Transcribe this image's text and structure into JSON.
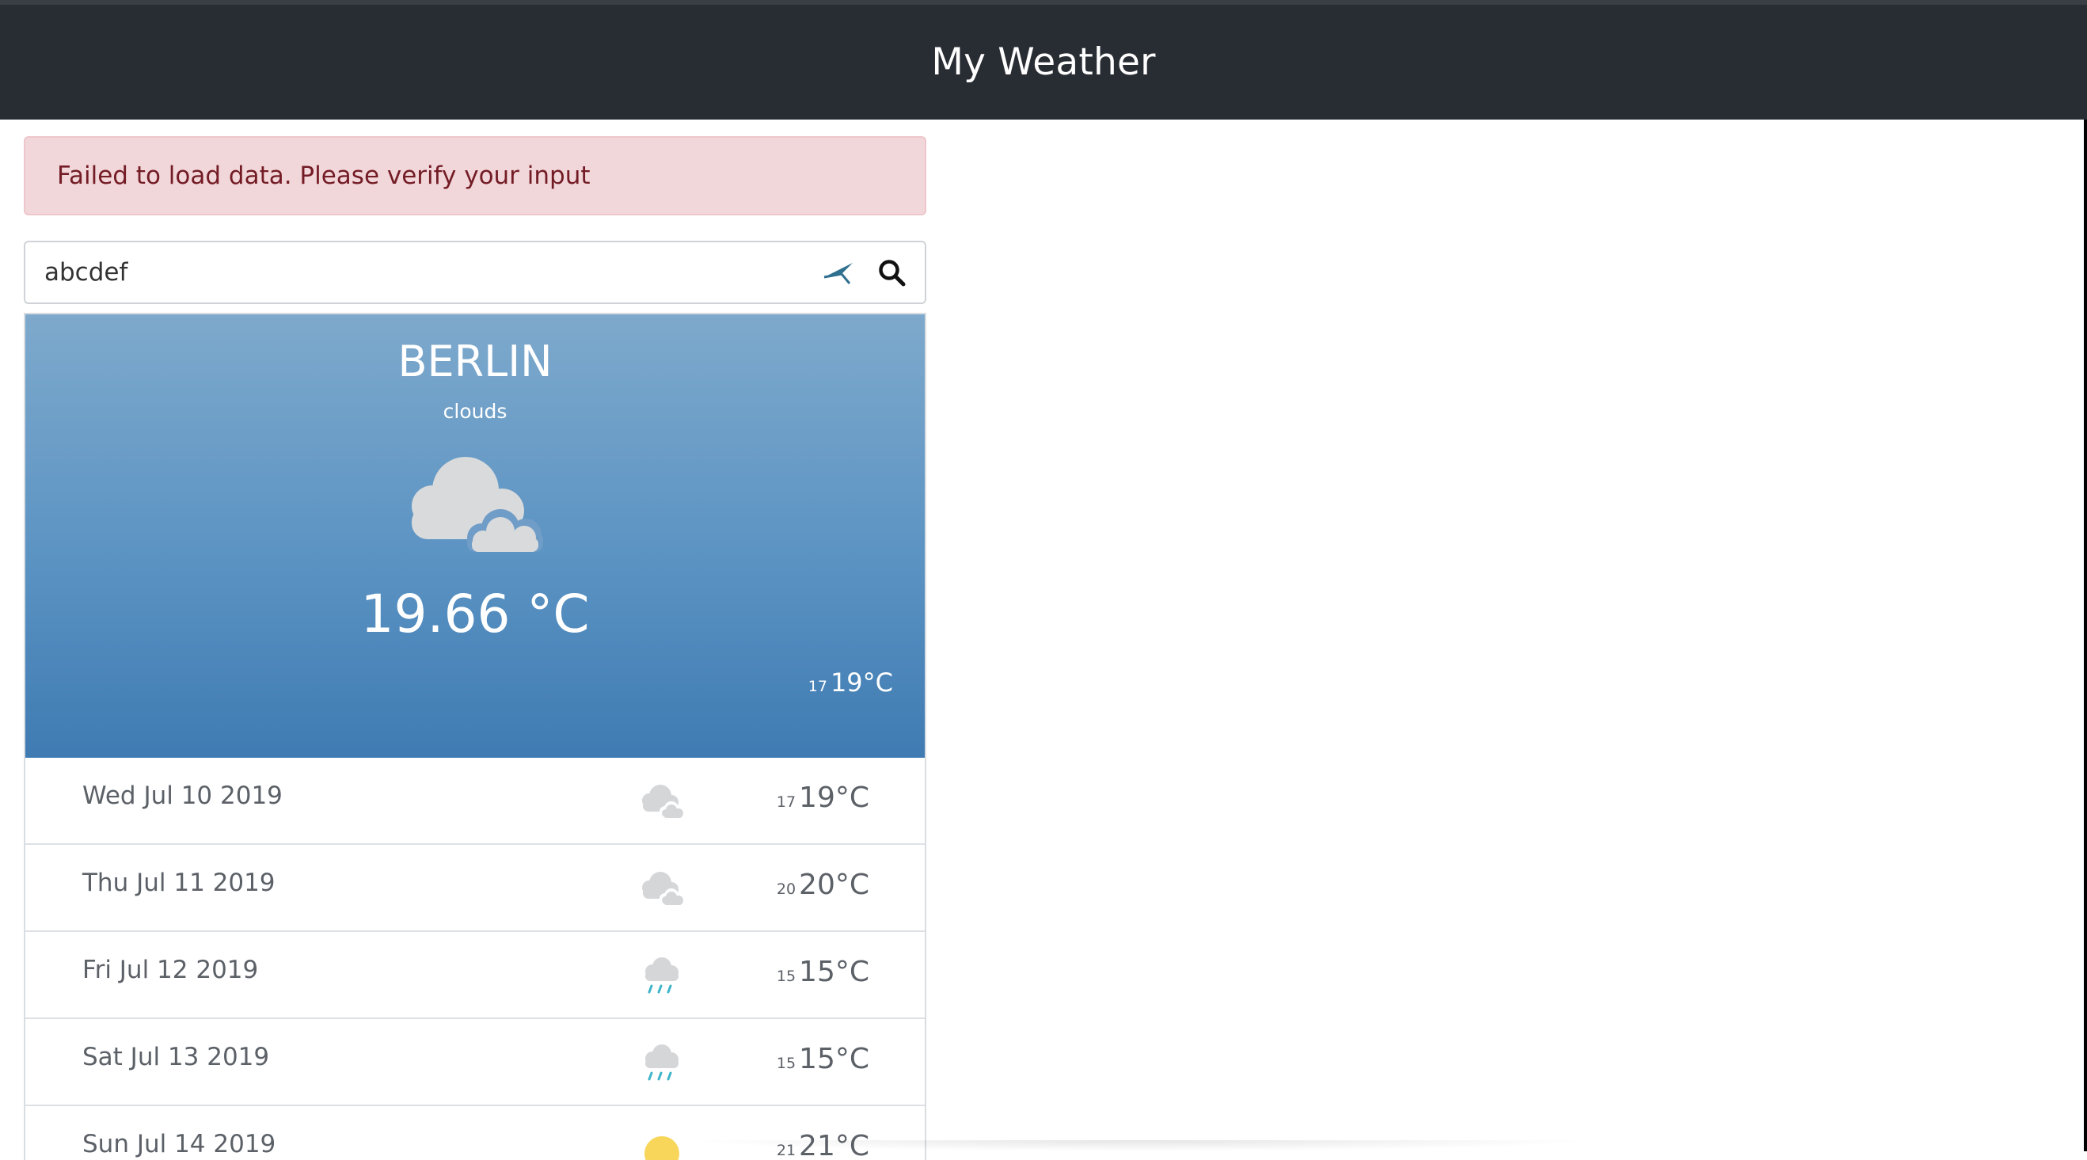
{
  "app": {
    "title": "My Weather"
  },
  "alert": {
    "message": "Failed to load data. Please verify your input"
  },
  "search": {
    "value": "abcdef"
  },
  "current": {
    "city": "BERLIN",
    "description": "clouds",
    "icon": "clouds-icon",
    "temperature": "19.66 °C",
    "low": "17",
    "high": "19°C"
  },
  "forecast": [
    {
      "date": "Wed Jul 10 2019",
      "icon": "clouds-icon",
      "low": "17",
      "high": "19°C"
    },
    {
      "date": "Thu Jul 11 2019",
      "icon": "clouds-icon",
      "low": "20",
      "high": "20°C"
    },
    {
      "date": "Fri Jul 12 2019",
      "icon": "rain-icon",
      "low": "15",
      "high": "15°C"
    },
    {
      "date": "Sat Jul 13 2019",
      "icon": "rain-icon",
      "low": "15",
      "high": "15°C"
    },
    {
      "date": "Sun Jul 14 2019",
      "icon": "sun-icon",
      "low": "21",
      "high": "21°C"
    }
  ],
  "colors": {
    "navbar": "#282c33",
    "alert_bg": "#f2d7da",
    "alert_text": "#731c25",
    "hero_top": "#7ea9cc",
    "hero_bottom": "#3f7bb2"
  }
}
